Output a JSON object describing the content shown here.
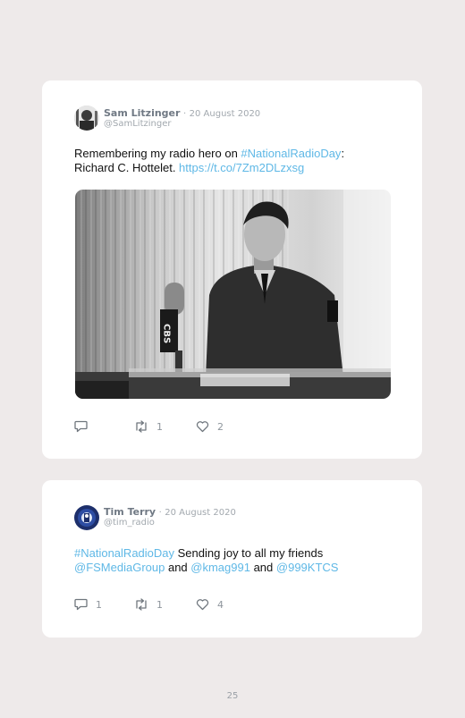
{
  "tweets": [
    {
      "name": "Sam Litzinger",
      "separator": "·",
      "date": "20 August 2020",
      "handle": "@SamLitzinger",
      "text": {
        "t1": "Remembering my radio hero on ",
        "hashtag": "#NationalRadioDay",
        "t2": ":",
        "t3": "Richard C. Hottelet. ",
        "url": "https://t.co/7Zm2DLzxsg"
      },
      "photo": {
        "mic_label": "CBS"
      },
      "actions": {
        "reply_icon": "reply-icon",
        "retweet_icon": "retweet-icon",
        "like_icon": "heart-icon",
        "replies": "",
        "retweets": "1",
        "likes": "2"
      }
    },
    {
      "name": "Tim Terry",
      "separator": "·",
      "date": "20 August 2020",
      "handle": "@tim_radio",
      "text": {
        "hashtag": "#NationalRadioDay",
        "t1": " Sending joy to all my friends",
        "m1": "@FSMediaGroup",
        "and1": " and ",
        "m2": "@kmag991",
        "and2": " and ",
        "m3": "@999KTCS"
      },
      "actions": {
        "reply_icon": "reply-icon",
        "retweet_icon": "retweet-icon",
        "like_icon": "heart-icon",
        "replies": "1",
        "retweets": "1",
        "likes": "4"
      }
    }
  ],
  "page_number": "25",
  "colors": {
    "link": "#5fb8e6",
    "background": "#eeeaea",
    "card": "#ffffff",
    "muted": "#a2a8ae"
  }
}
